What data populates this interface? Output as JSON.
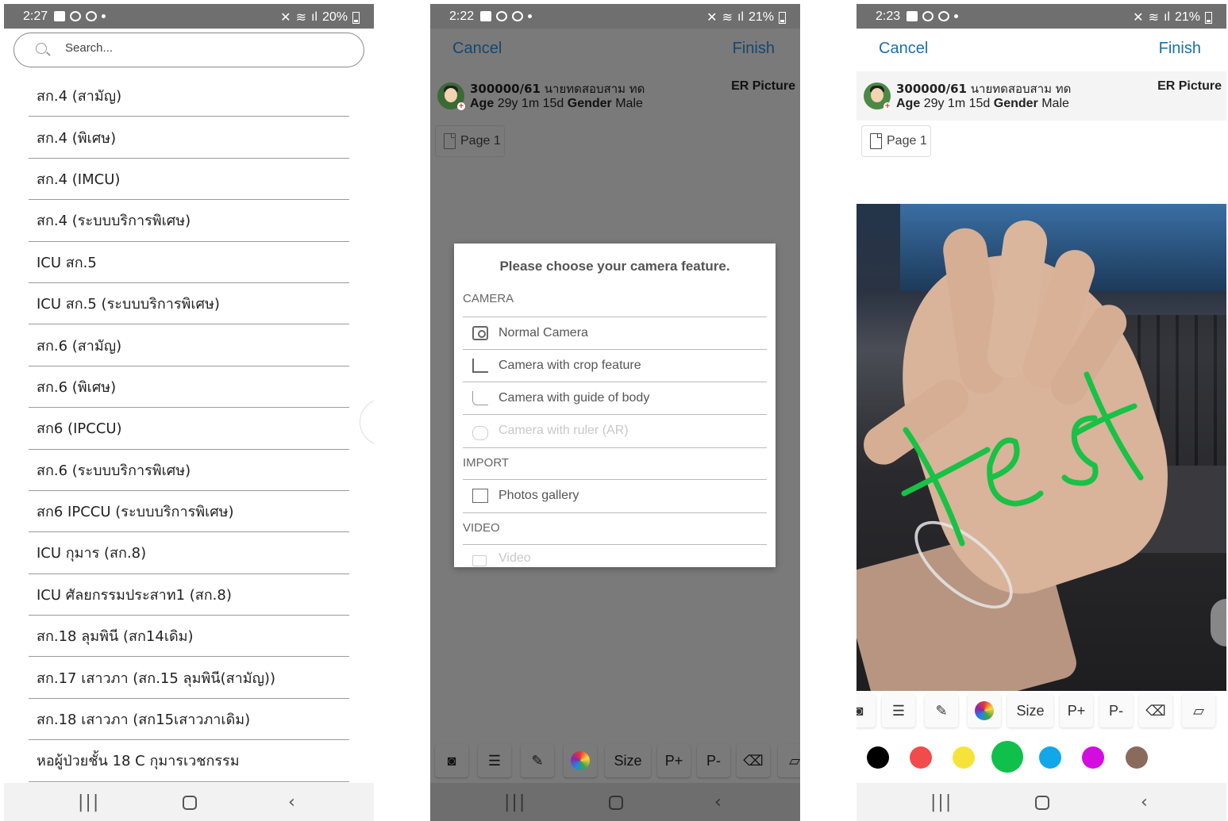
{
  "panel1": {
    "status": {
      "time": "2:27",
      "battery": "20%"
    },
    "search_placeholder": "Search...",
    "wards": [
      "สก.4 (สามัญ)",
      "สก.4 (พิเศษ)",
      "สก.4 (IMCU)",
      "สก.4 (ระบบบริการพิเศษ)",
      "ICU สก.5",
      "ICU สก.5 (ระบบบริการพิเศษ)",
      "สก.6 (สามัญ)",
      "สก.6 (พิเศษ)",
      "สก6 (IPCCU)",
      "สก.6 (ระบบบริการพิเศษ)",
      "สก6 IPCCU (ระบบบริการพิเศษ)",
      "ICU กุมาร (สก.8)",
      "ICU ศัลยกรรมประสาท1 (สก.8)",
      "สก.18 ลุมพินี (สก14เดิม)",
      "สก.17 เสาวภา (สก.15 ลุมพินี(สามัญ))",
      "สก.18 เสาวภา (สก15เสาวภาเดิม)",
      "หอผู้ป่วยชั้น 18 C กุมารเวชกรรม"
    ]
  },
  "panel2": {
    "status": {
      "time": "2:22",
      "battery": "21%"
    },
    "cancel": "Cancel",
    "finish": "Finish",
    "patient": {
      "hn": "300000/61",
      "name": "นายทดสอบสาม ทด",
      "age_label": "Age",
      "age": "29y 1m 15d",
      "gender_label": "Gender",
      "gender": "Male",
      "tag": "ER Picture"
    },
    "page_label": "Page 1",
    "modal": {
      "title": "Please choose your camera feature.",
      "camera_header": "CAMERA",
      "options": [
        "Normal Camera",
        "Camera with crop feature",
        "Camera with guide of body",
        "Camera with ruler (AR)"
      ],
      "import_header": "IMPORT",
      "import_option": "Photos gallery",
      "video_header": "VIDEO",
      "video_option": "Video"
    },
    "tools": {
      "size": "Size",
      "pplus": "P+",
      "pminus": "P-"
    }
  },
  "panel3": {
    "status": {
      "time": "2:23",
      "battery": "21%"
    },
    "cancel": "Cancel",
    "finish": "Finish",
    "patient": {
      "hn": "300000/61",
      "name": "นายทดสอบสาม ทด",
      "age_label": "Age",
      "age": "29y 1m 15d",
      "gender_label": "Gender",
      "gender": "Male",
      "tag": "ER Picture"
    },
    "page_label": "Page 1",
    "tools": {
      "size": "Size",
      "pplus": "P+",
      "pminus": "P-"
    },
    "palette": [
      "#000000",
      "#f24b4b",
      "#f6e33a",
      "#0fc04a",
      "#11a7e8",
      "#d50ce0",
      "#8a6a5d"
    ],
    "selected_color": "#0fc04a",
    "annotation_text": "test"
  }
}
